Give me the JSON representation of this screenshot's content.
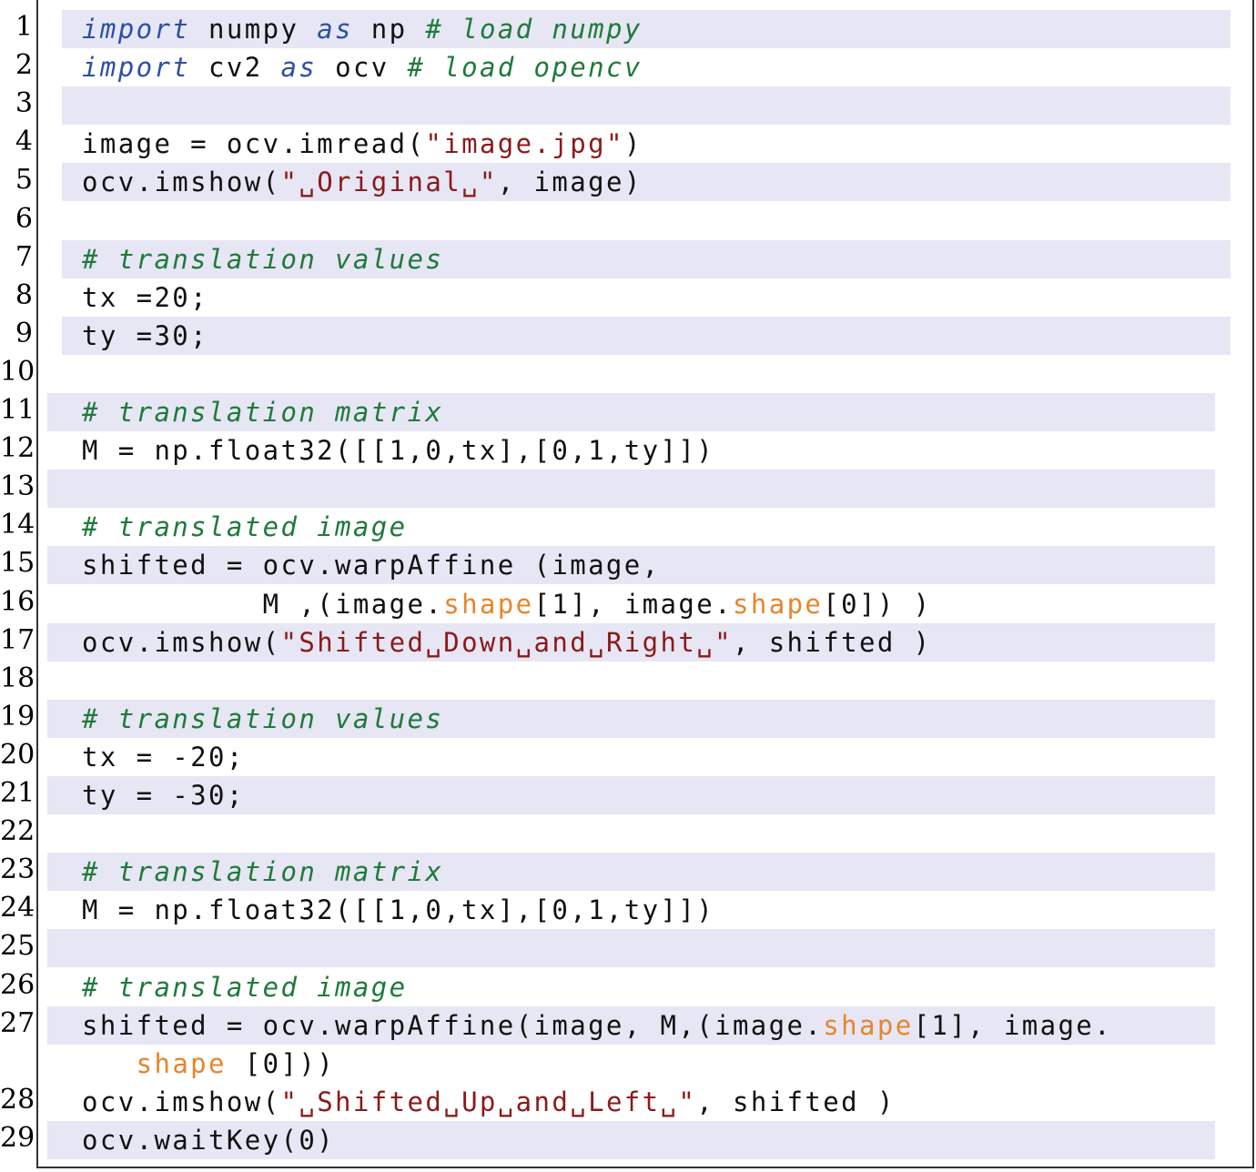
{
  "lines": [
    {
      "n": "1",
      "band": true,
      "tokens": [
        {
          "t": "import",
          "c": "kw"
        },
        {
          "t": " numpy ",
          "c": ""
        },
        {
          "t": "as",
          "c": "kw"
        },
        {
          "t": " np ",
          "c": ""
        },
        {
          "t": "# load numpy",
          "c": "cm"
        }
      ]
    },
    {
      "n": "2",
      "band": false,
      "tokens": [
        {
          "t": "import",
          "c": "kw"
        },
        {
          "t": " cv2 ",
          "c": ""
        },
        {
          "t": "as",
          "c": "kw"
        },
        {
          "t": " ocv ",
          "c": ""
        },
        {
          "t": "# load opencv",
          "c": "cm"
        }
      ]
    },
    {
      "n": "3",
      "band": true,
      "tokens": []
    },
    {
      "n": "4",
      "band": false,
      "tokens": [
        {
          "t": "image = ocv.imread(",
          "c": ""
        },
        {
          "t": "\"image.jpg\"",
          "c": "st"
        },
        {
          "t": ")",
          "c": ""
        }
      ]
    },
    {
      "n": "5",
      "band": true,
      "tokens": [
        {
          "t": "ocv.imshow(",
          "c": ""
        },
        {
          "t": "\"␣Original␣\"",
          "c": "st"
        },
        {
          "t": ", image)",
          "c": ""
        }
      ]
    },
    {
      "n": "6",
      "band": false,
      "tokens": []
    },
    {
      "n": "7",
      "band": true,
      "tokens": [
        {
          "t": "# translation values",
          "c": "cm"
        }
      ]
    },
    {
      "n": "8",
      "band": false,
      "tokens": [
        {
          "t": "tx =20;",
          "c": ""
        }
      ]
    },
    {
      "n": "9",
      "band": true,
      "tokens": [
        {
          "t": "ty =30;",
          "c": ""
        }
      ]
    },
    {
      "n": "10",
      "band": false,
      "tokens": []
    },
    {
      "n": "11",
      "band": true,
      "tokens": [
        {
          "t": "# translation matrix",
          "c": "cm"
        }
      ]
    },
    {
      "n": "12",
      "band": false,
      "tokens": [
        {
          "t": "M = np.float32([[1,0,tx],[0,1,ty]])",
          "c": ""
        }
      ]
    },
    {
      "n": "13",
      "band": true,
      "tokens": []
    },
    {
      "n": "14",
      "band": false,
      "tokens": [
        {
          "t": "# translated image",
          "c": "cm"
        }
      ]
    },
    {
      "n": "15",
      "band": true,
      "tokens": [
        {
          "t": "shifted = ocv.warpAffine (image,",
          "c": ""
        }
      ]
    },
    {
      "n": "16",
      "band": false,
      "tokens": [
        {
          "t": "          M ,(image.",
          "c": ""
        },
        {
          "t": "shape",
          "c": "at"
        },
        {
          "t": "[1], image.",
          "c": ""
        },
        {
          "t": "shape",
          "c": "at"
        },
        {
          "t": "[0]) )",
          "c": ""
        }
      ]
    },
    {
      "n": "17",
      "band": true,
      "tokens": [
        {
          "t": "ocv.imshow(",
          "c": ""
        },
        {
          "t": "\"Shifted␣Down␣and␣Right␣\"",
          "c": "st"
        },
        {
          "t": ", shifted )",
          "c": ""
        }
      ]
    },
    {
      "n": "18",
      "band": false,
      "tokens": []
    },
    {
      "n": "19",
      "band": true,
      "tokens": [
        {
          "t": "# translation values",
          "c": "cm"
        }
      ]
    },
    {
      "n": "20",
      "band": false,
      "tokens": [
        {
          "t": "tx = -20;",
          "c": ""
        }
      ]
    },
    {
      "n": "21",
      "band": true,
      "tokens": [
        {
          "t": "ty = -30;",
          "c": ""
        }
      ]
    },
    {
      "n": "22",
      "band": false,
      "tokens": []
    },
    {
      "n": "23",
      "band": true,
      "tokens": [
        {
          "t": "# translation matrix",
          "c": "cm"
        }
      ]
    },
    {
      "n": "24",
      "band": false,
      "tokens": [
        {
          "t": "M = np.float32([[1,0,tx],[0,1,ty]])",
          "c": ""
        }
      ]
    },
    {
      "n": "25",
      "band": true,
      "tokens": []
    },
    {
      "n": "26",
      "band": false,
      "tokens": [
        {
          "t": "# translated image",
          "c": "cm"
        }
      ]
    },
    {
      "n": "27",
      "band": true,
      "tokens": [
        {
          "t": "shifted = ocv.warpAffine(image, M,(image.",
          "c": ""
        },
        {
          "t": "shape",
          "c": "at"
        },
        {
          "t": "[1], image.",
          "c": ""
        }
      ]
    },
    {
      "n": "",
      "band": false,
      "tokens": [
        {
          "t": "   ",
          "c": ""
        },
        {
          "t": "shape",
          "c": "at"
        },
        {
          "t": " [0]))",
          "c": ""
        }
      ]
    },
    {
      "n": "28",
      "band": false,
      "tokens": [
        {
          "t": "ocv.imshow(",
          "c": ""
        },
        {
          "t": "\"␣Shifted␣Up␣and␣Left␣\"",
          "c": "st"
        },
        {
          "t": ", shifted )",
          "c": ""
        }
      ]
    },
    {
      "n": "29",
      "band": true,
      "tokens": [
        {
          "t": "ocv.waitKey(0)",
          "c": ""
        }
      ]
    }
  ]
}
